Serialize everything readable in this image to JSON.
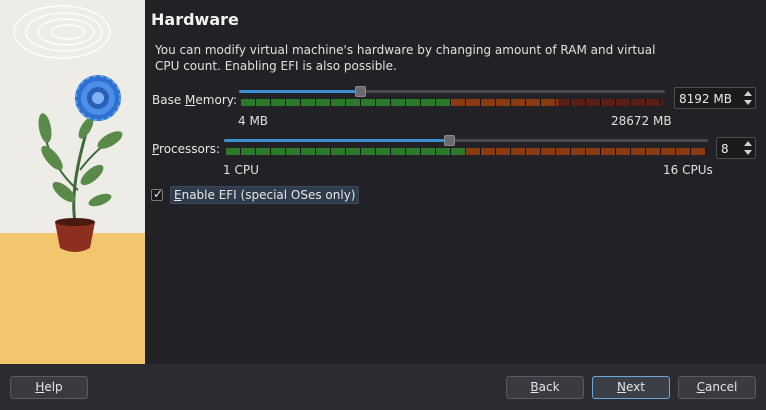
{
  "page": {
    "title": "Hardware",
    "description": "You can modify virtual machine's hardware by changing amount of RAM and virtual CPU count. Enabling EFI is also possible."
  },
  "memory": {
    "label_prefix": "Base ",
    "label_mnemonic": "M",
    "label_suffix": "emory:",
    "min_label": "4 MB",
    "max_label": "28672 MB",
    "value": "8192 MB",
    "min": 4,
    "max": 28672,
    "current": 8192,
    "green_fraction": 0.5,
    "red_fraction": 0.25,
    "fill_color": "#3d8fd1"
  },
  "processors": {
    "label_mnemonic": "P",
    "label_suffix": "rocessors:",
    "min_label": "1 CPU",
    "max_label": "16 CPUs",
    "value": "8",
    "min": 1,
    "max": 16,
    "current": 8,
    "green_fraction": 0.5
  },
  "efi": {
    "checked": true,
    "check_glyph": "✓",
    "label_mnemonic": "E",
    "label_suffix": "nable EFI (special OSes only)"
  },
  "buttons": {
    "help_mnemonic": "H",
    "help_rest": "elp",
    "back_mnemonic": "B",
    "back_rest": "ack",
    "next_mnemonic": "N",
    "next_rest": "ext",
    "cancel_mnemonic": "C",
    "cancel_rest": "ancel"
  },
  "colors": {
    "accent": "#3d8fd1",
    "ok_green": "#2a7a2a",
    "warn_orange": "#8a3a10",
    "danger_red": "#5a1e14"
  },
  "icons": {
    "spin_up": "arrow-up-icon",
    "spin_down": "arrow-down-icon",
    "checkbox": "check-icon"
  }
}
